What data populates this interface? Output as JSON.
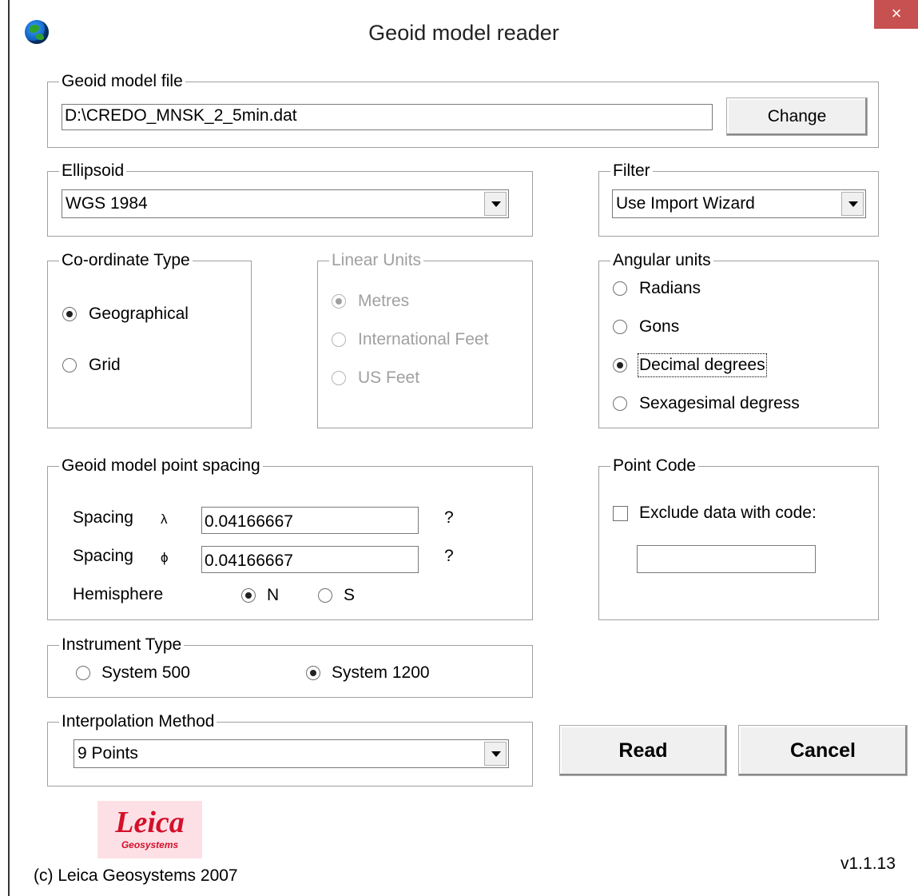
{
  "window": {
    "title": "Geoid model reader",
    "close_glyph": "×",
    "icon": "globe-icon"
  },
  "model_file": {
    "label": "Geoid model file",
    "path": "D:\\CREDO_MNSK_2_5min.dat",
    "change_label": "Change"
  },
  "ellipsoid": {
    "label": "Ellipsoid",
    "selected": "WGS 1984"
  },
  "filter": {
    "label": "Filter",
    "selected": "Use Import Wizard"
  },
  "coordinate_type": {
    "label": "Co-ordinate Type",
    "options": [
      "Geographical",
      "Grid"
    ],
    "selected": "Geographical"
  },
  "linear_units": {
    "label": "Linear Units",
    "options": [
      "Metres",
      "International Feet",
      "US Feet"
    ],
    "selected": "Metres",
    "enabled": false
  },
  "angular_units": {
    "label": "Angular units",
    "options": [
      "Radians",
      "Gons",
      "Decimal degrees",
      "Sexagesimal degress"
    ],
    "selected": "Decimal degrees"
  },
  "spacing": {
    "label": "Geoid model point spacing",
    "lambda_label": "Spacing",
    "lambda_symbol": "λ",
    "lambda_value": "0.04166667",
    "lambda_unit": "?",
    "phi_label": "Spacing",
    "phi_symbol": "ϕ",
    "phi_value": "0.04166667",
    "phi_unit": "?",
    "hemisphere_label": "Hemisphere",
    "hemisphere_options": [
      "N",
      "S"
    ],
    "hemisphere_selected": "N"
  },
  "point_code": {
    "label": "Point Code",
    "exclude_label": "Exclude data with code:",
    "exclude_checked": false,
    "code_value": ""
  },
  "instrument": {
    "label": "Instrument Type",
    "options": [
      "System 500",
      "System 1200"
    ],
    "selected": "System 1200"
  },
  "interpolation": {
    "label": "Interpolation Method",
    "selected": "9 Points"
  },
  "actions": {
    "read_label": "Read",
    "cancel_label": "Cancel"
  },
  "footer": {
    "logo_text": "Leica",
    "logo_sub": "Geosystems",
    "copyright": "(c) Leica Geosystems 2007",
    "version": "v1.1.13"
  },
  "colors": {
    "close_button": "#c75050",
    "logo_red": "#d4102a",
    "logo_bg": "#fde0e6",
    "disabled_text": "#a0a0a0"
  }
}
